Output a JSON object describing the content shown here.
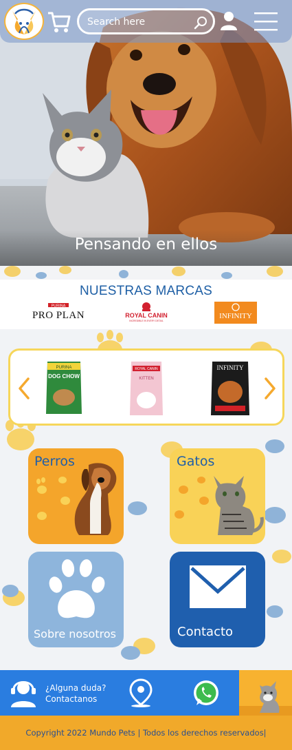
{
  "header": {
    "logo_icon": "mundo-pets-logo",
    "cart_icon": "cart-icon",
    "search_placeholder": "Search here",
    "search_icon": "search-icon",
    "user_icon": "user-icon",
    "menu_icon": "hamburger-menu-icon"
  },
  "hero": {
    "caption": "Pensando en ellos"
  },
  "brands": {
    "title": "NUESTRAS MARCAS",
    "items": [
      {
        "name": "PRO PLAN",
        "top_text": "PURINA",
        "color": "#111111"
      },
      {
        "name": "ROYAL CANIN",
        "sub_text": "INCREDIBLE IN EVERY DETAIL",
        "color": "#d2202f"
      },
      {
        "name": "INFINITY",
        "color": "#f28a1e"
      }
    ]
  },
  "carousel": {
    "prev_icon": "chevron-left-icon",
    "next_icon": "chevron-right-icon",
    "products": [
      {
        "brand": "PURINA",
        "name": "DOG CHOW",
        "color": "#2f8a3c"
      },
      {
        "brand": "ROYAL CANIN",
        "name": "KITTEN",
        "color": "#f2b8c8"
      },
      {
        "brand": "INFINITY",
        "name": "",
        "color": "#1b1b1b"
      }
    ]
  },
  "categories": [
    {
      "label": "Perros",
      "color": "#f4a52b",
      "label_color": "#1f5ea8"
    },
    {
      "label": "Gatos",
      "color": "#f9d257",
      "label_color": "#1f5ea8"
    },
    {
      "label": "Sobre nosotros",
      "color": "#8eb5dc",
      "label_color": "#ffffff"
    },
    {
      "label": "Contacto",
      "color": "#1f5fae",
      "label_color": "#ffffff"
    }
  ],
  "footer": {
    "help_line1": "¿Alguna duda?",
    "help_line2": "Contactanos",
    "support_icon": "support-agent-icon",
    "location_icon": "location-pin-icon",
    "whatsapp_icon": "whatsapp-icon",
    "copyright": "Copyright 2022 Mundo Pets | Todos los derechos reservados|"
  },
  "colors": {
    "accent_blue": "#2a7de0",
    "accent_orange": "#f1a92a",
    "accent_yellow": "#f6d65a"
  }
}
